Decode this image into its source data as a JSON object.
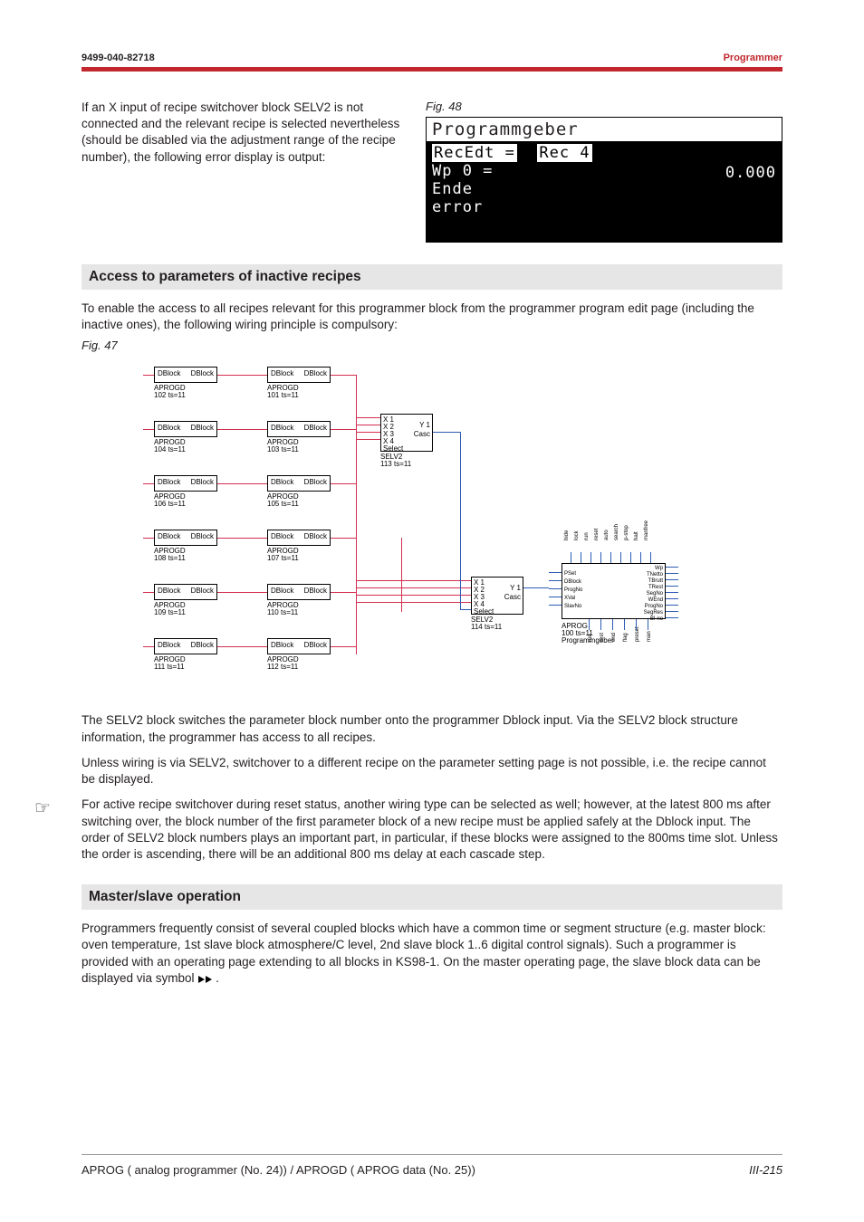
{
  "header": {
    "left": "9499-040-82718",
    "right": "Programmer"
  },
  "intro": {
    "text": "If an X input of recipe switchover block SELV2 is not connected and the relevant recipe is selected nevertheless  (should be disabled via the adjustment range of the recipe number), the following error display is output:",
    "fig48": "Fig. 48"
  },
  "device": {
    "title": "Programmgeber",
    "line1_left": "RecEdt =",
    "line1_right_hl": "Rec   4",
    "line2_left": "Wp 0   =",
    "line2_right": "0.000",
    "line3": "Ende",
    "line4": "error"
  },
  "sec1": {
    "head": "Access to parameters of inactive recipes",
    "para": "To enable the access to all recipes relevant for this programmer block from the programmer program edit page (including the inactive ones), the following wiring principle is compulsory:",
    "fig47": "Fig. 47",
    "after1": "The SELV2 block switches the parameter block number onto the programmer Dblock input.  Via the SELV2 block structure information, the programmer has access to all recipes.",
    "after2": "Unless wiring is via SELV2, switchover to a different recipe on the parameter setting page is not possible, i.e. the recipe cannot be displayed.",
    "note": "For active recipe switchover during reset status, another wiring type can be selected as well; however, at the latest 800 ms after switching over, the block number of the first parameter block of a new recipe must be applied safely at the Dblock input. The order of SELV2 block numbers plays an important part, in particular, if these blocks were assigned to the 800ms time slot.   Unless the order is ascending, there will be an additional  800 ms delay at each cascade step."
  },
  "diagram": {
    "dblock_in": "DBlock",
    "dblock_out": "DBlock",
    "labels_left_col": [
      {
        "l1": "APROGD",
        "l2": "102 ts=11"
      },
      {
        "l1": "APROGD",
        "l2": "104 ts=11"
      },
      {
        "l1": "APROGD",
        "l2": "106 ts=11"
      },
      {
        "l1": "APROGD",
        "l2": "108 ts=11"
      },
      {
        "l1": "APROGD",
        "l2": "109 ts=11"
      },
      {
        "l1": "APROGD",
        "l2": "111 ts=11"
      }
    ],
    "labels_right_col": [
      {
        "l1": "APROGD",
        "l2": "101 ts=11"
      },
      {
        "l1": "APROGD",
        "l2": "103 ts=11"
      },
      {
        "l1": "APROGD",
        "l2": "105 ts=11"
      },
      {
        "l1": "APROGD",
        "l2": "107 ts=11"
      },
      {
        "l1": "APROGD",
        "l2": "110 ts=11"
      },
      {
        "l1": "APROGD",
        "l2": "112 ts=11"
      }
    ],
    "selv2_1": {
      "name": "SELV2",
      "sub": "113 ts=11",
      "ports_left": [
        "X 1",
        "X 2",
        "X 3",
        "X 4",
        "Select"
      ],
      "ports_right": [
        "Y 1",
        "Casc"
      ]
    },
    "selv2_2": {
      "name": "SELV2",
      "sub": "114 ts=11",
      "ports_left": [
        "X 1",
        "X 2",
        "X 3",
        "X 4",
        "Select"
      ],
      "ports_right": [
        "Y 1",
        "Casc"
      ]
    },
    "aprog": {
      "name": "APROG",
      "sub": "100 ts=11",
      "title": "Programmgeber",
      "left_ports": [
        "PSet",
        "DBlock",
        "ProgNo",
        "XVal",
        "SlavNo"
      ],
      "top_ports": [
        "hide",
        "lock",
        "run",
        "reset",
        "auto",
        "search",
        "p-stop",
        "halt",
        "manfree"
      ],
      "right_ports": [
        "Wp",
        "TNetto",
        "TBrutt",
        "TRest",
        "SegNo",
        "WEnd",
        "ProgNo",
        "SegRes",
        "Bl-no"
      ],
      "bottom_ports": [
        "run",
        "rest",
        "end",
        "flag",
        "preset",
        "man"
      ]
    }
  },
  "sec2": {
    "head": "Master/slave operation",
    "para": "Programmers frequently consist of several coupled blocks which have a common time or segment structure  (e.g. master block: oven temperature, 1st slave block atmosphere/C level, 2nd slave block 1..6 digital control signals). Such a programmer is provided with an operating page extending to all blocks in KS98-1. On the master operating page, the slave block data can be displayed via symbol  "
  },
  "footer": {
    "left": "APROG ( analog programmer (No. 24)) / APROGD ( APROG data (No. 25))",
    "right": "III-215"
  }
}
